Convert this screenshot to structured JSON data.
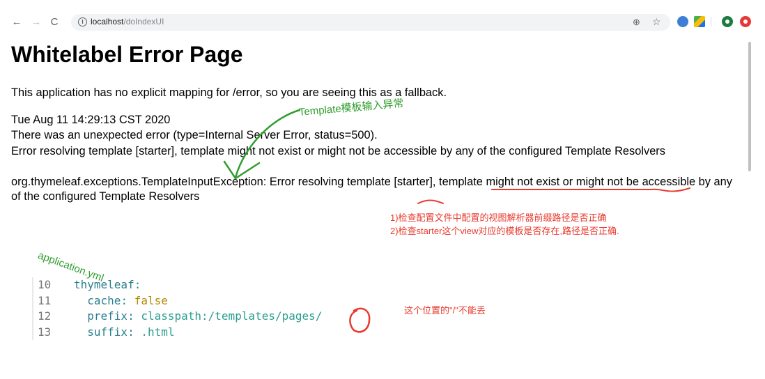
{
  "browser": {
    "url_host": "localhost",
    "url_path": "/doIndexUI",
    "back_icon": "arrow-left-icon",
    "forward_icon": "arrow-right-icon",
    "reload_icon": "reload-icon"
  },
  "page": {
    "title": "Whitelabel Error Page",
    "fallback_text": "This application has no explicit mapping for /error, so you are seeing this as a fallback.",
    "timestamp": "Tue Aug 11 14:29:13 CST 2020",
    "error_summary": "There was an unexpected error (type=Internal Server Error, status=500).",
    "error_resolving": "Error resolving template [starter], template might not exist or might not be accessible by any of the configured Template Resolvers",
    "exception": "org.thymeleaf.exceptions.TemplateInputException: Error resolving template [starter], template might not exist or might not be accessible by any of the configured Template Resolvers"
  },
  "annotations": {
    "template_note": "Template模板输入异常",
    "check_1": "1)检查配置文件中配置的视图解析器前缀路径是否正确",
    "check_2": "2)检查starter这个view对应的模板是否存在,路径是否正确.",
    "app_yml": "application.yml",
    "slash_note": "这个位置的\"/\"不能丢"
  },
  "code": {
    "lines": [
      {
        "num": "10",
        "key": "thymeleaf",
        "sep": ":",
        "value": ""
      },
      {
        "num": "11",
        "key": "cache",
        "sep": ": ",
        "value": "false"
      },
      {
        "num": "12",
        "key": "prefix",
        "sep": ": ",
        "value": "classpath:/templates/pages/"
      },
      {
        "num": "13",
        "key": "suffix",
        "sep": ": ",
        "value": ".html"
      }
    ]
  },
  "colors": {
    "annotation_green": "#2e9e2e",
    "annotation_red": "#e83a2e"
  }
}
